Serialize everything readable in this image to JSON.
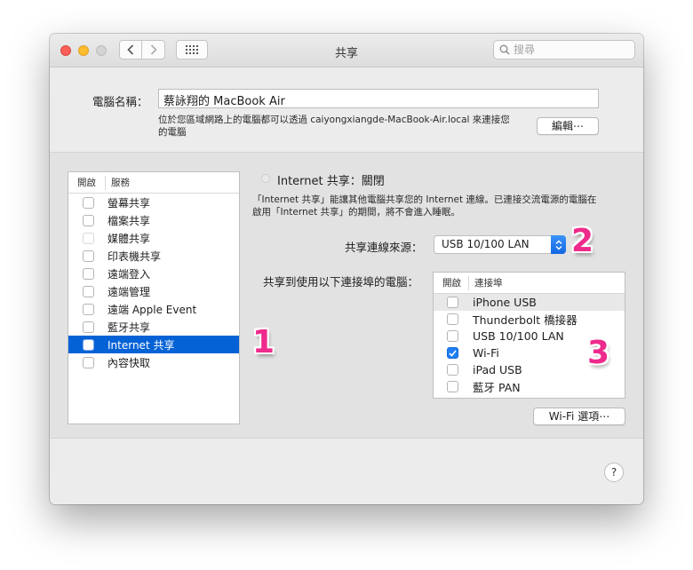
{
  "window": {
    "title": "共享"
  },
  "search": {
    "placeholder": "搜尋"
  },
  "computer_name": {
    "label": "電腦名稱：",
    "value": "蔡詠翔的 MacBook Air",
    "desc_line1": "位於您區域網路上的電腦都可以透過 caiyongxiangde-MacBook-Air.local 來連接您",
    "desc_line2": "的電腦",
    "edit_button": "編輯⋯"
  },
  "services": {
    "col_on": "開啟",
    "col_service": "服務",
    "items": [
      {
        "label": "螢幕共享",
        "checked": false,
        "enabled": true,
        "selected": false
      },
      {
        "label": "檔案共享",
        "checked": false,
        "enabled": true,
        "selected": false
      },
      {
        "label": "媒體共享",
        "checked": false,
        "enabled": false,
        "selected": false
      },
      {
        "label": "印表機共享",
        "checked": false,
        "enabled": true,
        "selected": false
      },
      {
        "label": "遠端登入",
        "checked": false,
        "enabled": true,
        "selected": false
      },
      {
        "label": "遠端管理",
        "checked": false,
        "enabled": true,
        "selected": false
      },
      {
        "label": "遠端 Apple Event",
        "checked": false,
        "enabled": true,
        "selected": false
      },
      {
        "label": "藍牙共享",
        "checked": false,
        "enabled": true,
        "selected": false
      },
      {
        "label": "Internet 共享",
        "checked": false,
        "enabled": true,
        "selected": true
      },
      {
        "label": "內容快取",
        "checked": false,
        "enabled": true,
        "selected": false
      }
    ]
  },
  "detail": {
    "status": "Internet 共享：關閉",
    "desc_line1": "「Internet 共享」能讓其他電腦共享您的 Internet 連線。已連接交流電源的電腦在",
    "desc_line2": "啟用「Internet 共享」的期間，將不會進入睡眠。",
    "source_label": "共享連線來源：",
    "source_value": "USB 10/100 LAN",
    "ports_label": "共享到使用以下連接埠的電腦：",
    "ports_col_on": "開啟",
    "ports_col_port": "連接埠",
    "ports": [
      {
        "label": "iPhone USB",
        "checked": false
      },
      {
        "label": "Thunderbolt 橋接器",
        "checked": false
      },
      {
        "label": "USB 10/100 LAN",
        "checked": false
      },
      {
        "label": "Wi-Fi",
        "checked": true
      },
      {
        "label": "iPad USB",
        "checked": false
      },
      {
        "label": "藍牙 PAN",
        "checked": false
      }
    ],
    "wifi_options": "Wi-Fi 選項⋯"
  },
  "help": "?",
  "annotations": {
    "one": "1",
    "two": "2",
    "three": "3"
  },
  "colors": {
    "selection": "#0462d6",
    "annotation": "#ee2b8c",
    "checkbox_checked": "#1f7ef5"
  }
}
